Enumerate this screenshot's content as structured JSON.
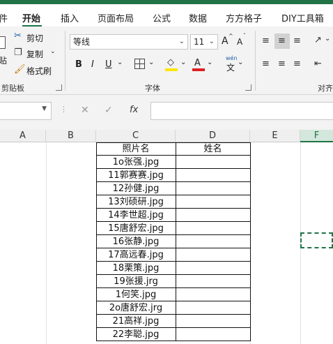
{
  "tabs": [
    "件",
    "开始",
    "插入",
    "页面布局",
    "公式",
    "数据",
    "方方格子",
    "DIY工具箱"
  ],
  "ribbon": {
    "clipboard": {
      "paste_partial": "贴",
      "cut": "剪切",
      "copy": "复制",
      "format_painter": "格式刷",
      "group_label": "剪贴板"
    },
    "font": {
      "name": "等线",
      "size": "11",
      "group_label": "字体",
      "grow": "A",
      "shrink": "A",
      "bold": "B",
      "italic": "I",
      "underline": "U",
      "font_color_glyph": "A",
      "wen": "wén",
      "wen_char": "文"
    },
    "align": {
      "group_label": "对齐"
    }
  },
  "formula_bar": {
    "fx": "fx",
    "cancel": "✕",
    "confirm": "✓"
  },
  "columns": [
    "A",
    "B",
    "C",
    "D",
    "E",
    "F"
  ],
  "table": {
    "headers": [
      "照片名",
      "姓名"
    ],
    "rows": [
      "1o张强.jpg",
      "11郭赛赛.jpg",
      "12孙健.jpg",
      "13刘硕研.jpg",
      "14李世超.jpg",
      "15唐舒宏.jpg",
      "16张静.jpg",
      "17高远春.jpg",
      "18栗策.jpg",
      "19张援.jrg",
      "1何笑.jpg",
      "2o唐舒宏.jrg",
      "21高祥.jpg",
      "22李聪.jpg"
    ]
  },
  "colors": {
    "accent": "#217346",
    "font_color_bar": "#e02020",
    "highlight_bar": "#ffe600"
  }
}
